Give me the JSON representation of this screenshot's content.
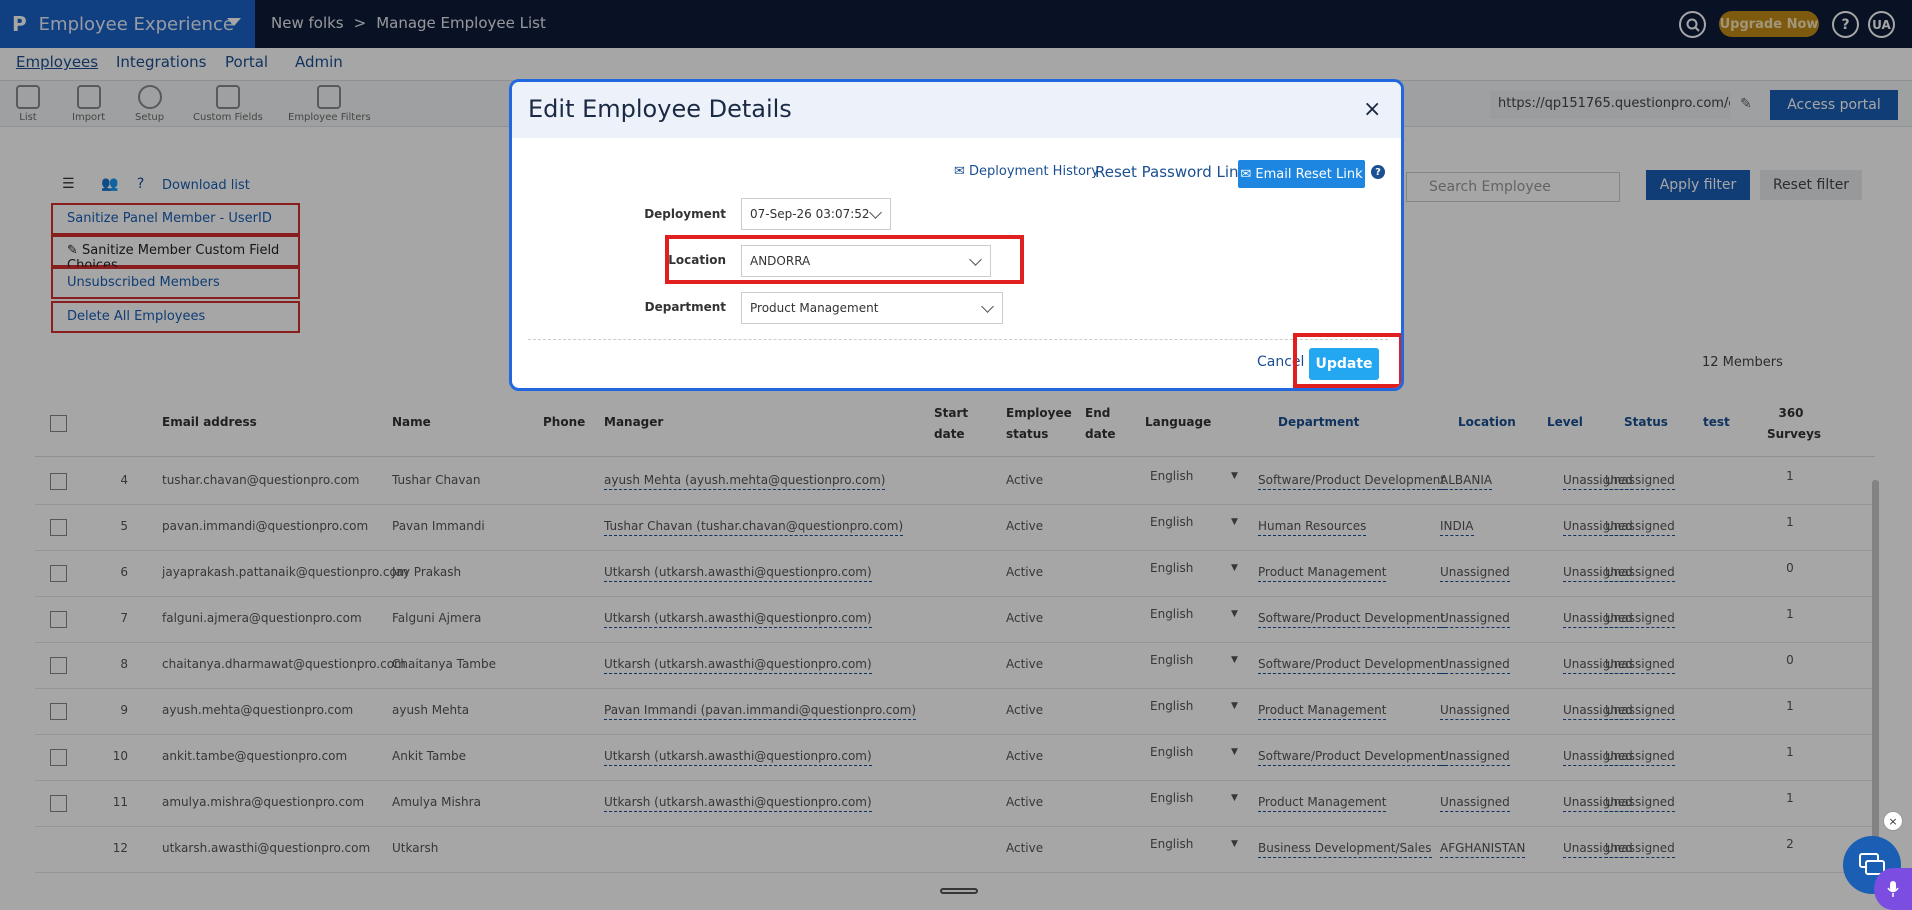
{
  "topbar": {
    "logo": "P",
    "app_title": "Employee Experience",
    "breadcrumb": [
      "New folks",
      ">",
      "Manage Employee List"
    ],
    "upgrade_label": "Upgrade Now",
    "help_label": "?",
    "user_initials": "UA"
  },
  "nav": {
    "tabs": [
      "Employees",
      "Integrations",
      "Portal",
      "Admin"
    ]
  },
  "toolbar": {
    "tools": [
      "List",
      "Import",
      "Setup",
      "Custom Fields",
      "Employee Filters"
    ],
    "url": "https://qp151765.questionpro.com/e:",
    "access_label": "Access portal"
  },
  "leftpanel": {
    "download_label": "Download list",
    "actions": [
      "Sanitize Panel Member - UserID",
      "Sanitize Member Custom Field Choices",
      "Unsubscribed Members",
      "Delete All Employees"
    ]
  },
  "filters": {
    "search_placeholder": "Search Employee",
    "apply_label": "Apply filter",
    "reset_label": "Reset filter",
    "members_count": "12 Members"
  },
  "table": {
    "headers": {
      "email": "Email address",
      "name": "Name",
      "phone": "Phone",
      "manager": "Manager",
      "start_date": "Start date",
      "employee_status": "Employee status",
      "end_date": "End date",
      "language": "Language",
      "department": "Department",
      "location": "Location",
      "level": "Level",
      "status": "Status",
      "test": "test",
      "surveys": "360 Surveys"
    },
    "rows": [
      {
        "n": "4",
        "email": "tushar.chavan@questionpro.com",
        "name": "Tushar Chavan",
        "manager": "ayush Mehta (ayush.mehta@questionpro.com)",
        "status": "Active",
        "lang": "English",
        "dept": "Software/Product Development",
        "loc": "ALBANIA",
        "level": "Unassigned",
        "st": "Unassigned",
        "surveys": "1"
      },
      {
        "n": "5",
        "email": "pavan.immandi@questionpro.com",
        "name": "Pavan Immandi",
        "manager": "Tushar Chavan (tushar.chavan@questionpro.com)",
        "status": "Active",
        "lang": "English",
        "dept": "Human Resources",
        "loc": "INDIA",
        "level": "Unassigned",
        "st": "Unassigned",
        "surveys": "1"
      },
      {
        "n": "6",
        "email": "jayaprakash.pattanaik@questionpro.com",
        "name": "Jay Prakash",
        "manager": "Utkarsh (utkarsh.awasthi@questionpro.com)",
        "status": "Active",
        "lang": "English",
        "dept": "Product Management",
        "loc": "Unassigned",
        "level": "Unassigned",
        "st": "Unassigned",
        "surveys": "0"
      },
      {
        "n": "7",
        "email": "falguni.ajmera@questionpro.com",
        "name": "Falguni Ajmera",
        "manager": "Utkarsh (utkarsh.awasthi@questionpro.com)",
        "status": "Active",
        "lang": "English",
        "dept": "Software/Product Development",
        "loc": "Unassigned",
        "level": "Unassigned",
        "st": "Unassigned",
        "surveys": "1"
      },
      {
        "n": "8",
        "email": "chaitanya.dharmawat@questionpro.com",
        "name": "Chaitanya Tambe",
        "manager": "Utkarsh (utkarsh.awasthi@questionpro.com)",
        "status": "Active",
        "lang": "English",
        "dept": "Software/Product Development",
        "loc": "Unassigned",
        "level": "Unassigned",
        "st": "Unassigned",
        "surveys": "0"
      },
      {
        "n": "9",
        "email": "ayush.mehta@questionpro.com",
        "name": "ayush Mehta",
        "manager": "Pavan Immandi (pavan.immandi@questionpro.com)",
        "status": "Active",
        "lang": "English",
        "dept": "Product Management",
        "loc": "Unassigned",
        "level": "Unassigned",
        "st": "Unassigned",
        "surveys": "1"
      },
      {
        "n": "10",
        "email": "ankit.tambe@questionpro.com",
        "name": "Ankit Tambe",
        "manager": "Utkarsh (utkarsh.awasthi@questionpro.com)",
        "status": "Active",
        "lang": "English",
        "dept": "Software/Product Development",
        "loc": "Unassigned",
        "level": "Unassigned",
        "st": "Unassigned",
        "surveys": "1"
      },
      {
        "n": "11",
        "email": "amulya.mishra@questionpro.com",
        "name": "Amulya Mishra",
        "manager": "Utkarsh (utkarsh.awasthi@questionpro.com)",
        "status": "Active",
        "lang": "English",
        "dept": "Product Management",
        "loc": "Unassigned",
        "level": "Unassigned",
        "st": "Unassigned",
        "surveys": "1"
      },
      {
        "n": "12",
        "email": "utkarsh.awasthi@questionpro.com",
        "name": "Utkarsh",
        "manager": "",
        "status": "Active",
        "lang": "English",
        "dept": "Business Development/Sales",
        "loc": "AFGHANISTAN",
        "level": "Unassigned",
        "st": "Unassigned",
        "surveys": "2"
      }
    ]
  },
  "modal": {
    "title": "Edit Employee Details",
    "close": "×",
    "deployment_history": "Deployment History",
    "reset_password": "Reset Password Link",
    "email_reset": "Email Reset Link",
    "help": "?",
    "fields": {
      "deployment_label": "Deployment",
      "deployment_value": "07-Sep-26 03:07:52",
      "location_label": "Location",
      "location_value": "ANDORRA",
      "department_label": "Department",
      "department_value": "Product Management"
    },
    "cancel_label": "Cancel",
    "update_label": "Update"
  },
  "chat": {
    "close": "×"
  },
  "colors": {
    "topbar": "#0f1d3a",
    "brand": "#1a63c8",
    "primary": "#1a5fb4",
    "highlight": "#e01f1f",
    "update": "#22a7f0"
  }
}
